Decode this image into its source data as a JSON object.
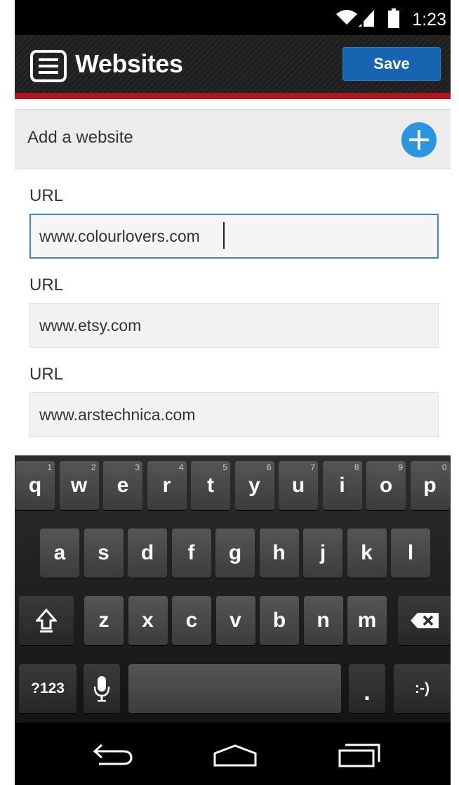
{
  "status_bar": {
    "time": "1:23",
    "icons": [
      "wifi-icon",
      "signal-icon",
      "battery-icon"
    ]
  },
  "action_bar": {
    "title": "Websites",
    "save_label": "Save",
    "accent_color": "#b5121b",
    "button_color": "#1765b0"
  },
  "add_website": {
    "label": "Add a website",
    "icon": "plus-circle-icon"
  },
  "fields": [
    {
      "label": "URL",
      "value": "www.colourlovers.com",
      "focused": true
    },
    {
      "label": "URL",
      "value": "www.etsy.com",
      "focused": false
    },
    {
      "label": "URL",
      "value": "www.arstechnica.com",
      "focused": false
    }
  ],
  "keyboard": {
    "row1": [
      {
        "k": "q",
        "h": "1"
      },
      {
        "k": "w",
        "h": "2"
      },
      {
        "k": "e",
        "h": "3"
      },
      {
        "k": "r",
        "h": "4"
      },
      {
        "k": "t",
        "h": "5"
      },
      {
        "k": "y",
        "h": "6"
      },
      {
        "k": "u",
        "h": "7"
      },
      {
        "k": "i",
        "h": "8"
      },
      {
        "k": "o",
        "h": "9"
      },
      {
        "k": "p",
        "h": "0"
      }
    ],
    "row2": [
      "a",
      "s",
      "d",
      "f",
      "g",
      "h",
      "j",
      "k",
      "l"
    ],
    "row3": [
      "z",
      "x",
      "c",
      "v",
      "b",
      "n",
      "m"
    ],
    "symbols_label": "?123",
    "period_label": ".",
    "smiley_label": ":-)",
    "shift_icon": "shift-icon",
    "backspace_icon": "backspace-icon",
    "mic_icon": "microphone-icon"
  },
  "nav_bar": {
    "icons": [
      "back-icon",
      "home-icon",
      "recents-icon"
    ]
  }
}
